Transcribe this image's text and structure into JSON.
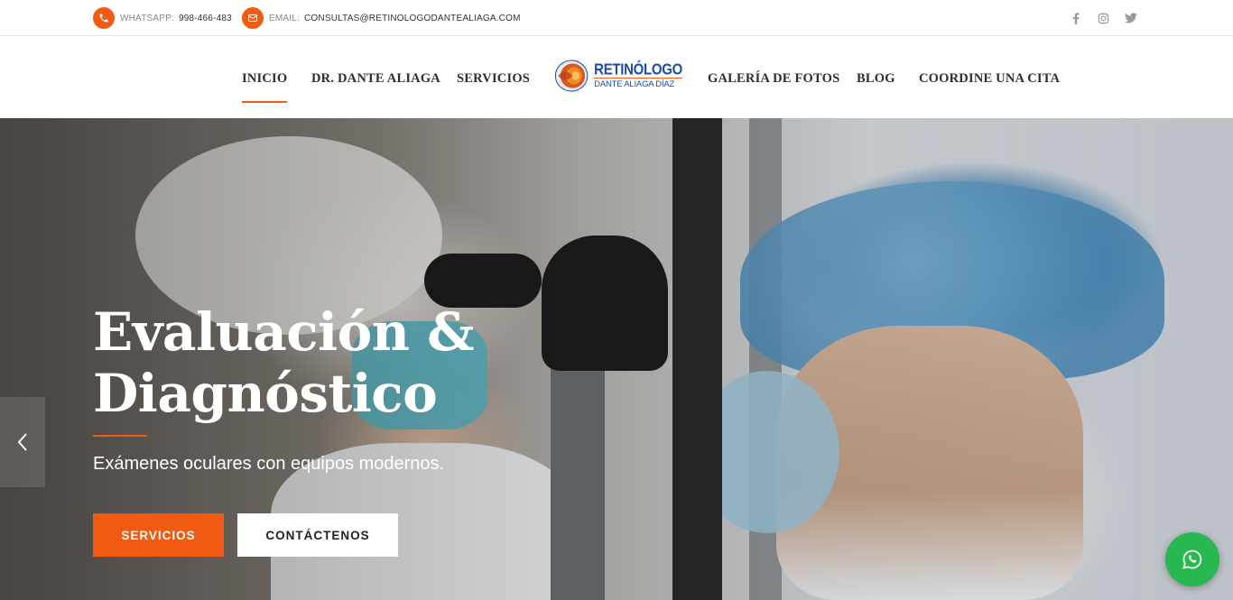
{
  "topbar": {
    "whatsapp_label": "WHATSAPP:",
    "whatsapp_value": "998-466-483",
    "email_label": "EMAIL:",
    "email_value": "CONSULTAS@RETINOLOGODANTEALIAGA.COM",
    "social": [
      "facebook-icon",
      "instagram-icon",
      "twitter-icon"
    ]
  },
  "nav": {
    "items": [
      {
        "label": "INICIO",
        "active": true
      },
      {
        "label": "DR. DANTE ALIAGA"
      },
      {
        "label": "SERVICIOS"
      },
      {
        "label": "GALERÍA DE FOTOS"
      },
      {
        "label": "BLOG"
      },
      {
        "label": "COORDINE UNA CITA"
      }
    ],
    "logo": {
      "line1": "RETINÓLOGO",
      "line2": "DANTE ALIAGA DÍAZ"
    }
  },
  "hero": {
    "title_line1": "Evaluación &",
    "title_line2": "Diagnóstico",
    "subtitle": "Exámenes oculares con equipos modernos.",
    "btn_primary": "SERVICIOS",
    "btn_secondary": "CONTÁCTENOS"
  },
  "colors": {
    "accent": "#f05a12",
    "logo_blue": "#1a4ea8",
    "whatsapp": "#27b94f"
  }
}
